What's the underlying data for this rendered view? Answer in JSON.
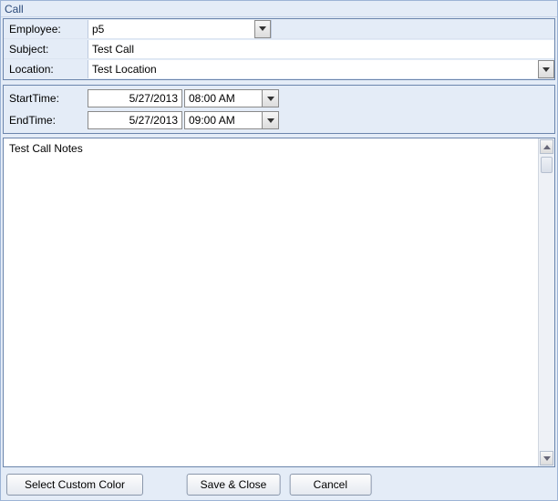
{
  "window": {
    "title": "Call"
  },
  "form": {
    "employee_label": "Employee:",
    "employee_value": "p5",
    "subject_label": "Subject:",
    "subject_value": "Test Call",
    "location_label": "Location:",
    "location_value": "Test Location"
  },
  "times": {
    "start_label": "StartTime:",
    "start_date": "5/27/2013",
    "start_time": "08:00 AM",
    "end_label": "EndTime:",
    "end_date": "5/27/2013",
    "end_time": "09:00 AM"
  },
  "notes": {
    "value": "Test Call Notes"
  },
  "buttons": {
    "custom_color": "Select Custom Color",
    "save_close": "Save & Close",
    "cancel": "Cancel"
  }
}
